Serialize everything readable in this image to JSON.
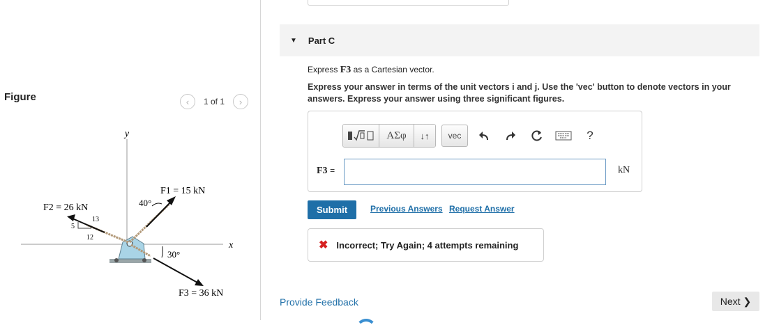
{
  "figure": {
    "title": "Figure",
    "pager_text": "1 of 1",
    "labels": {
      "y_axis": "y",
      "x_axis": "x",
      "f1": "F1 = 15 kN",
      "f2": "F2 = 26 kN",
      "f3": "F3 = 36 kN",
      "angle_40": "40°",
      "angle_30": "30°",
      "slope_5": "5",
      "slope_12": "12",
      "slope_13": "13"
    }
  },
  "part": {
    "caret": "▼",
    "title": "Part C",
    "prompt_prefix": "Express",
    "prompt_var": "F3",
    "prompt_suffix": "as a Cartesian vector.",
    "instructions": "Express your answer in terms of the unit vectors i and j. Use the 'vec' button to denote vectors in your answers. Express your answer using three significant figures."
  },
  "toolbar": {
    "symbols_label": "ΑΣφ",
    "updown_label": "↓↑",
    "vec_label": "vec",
    "help_label": "?"
  },
  "answer": {
    "label": "F3",
    "equals": "=",
    "value": "",
    "unit": "kN"
  },
  "actions": {
    "submit_label": "Submit",
    "previous_answers_label": "Previous Answers",
    "request_answer_label": "Request Answer"
  },
  "feedback": {
    "icon": "x-mark",
    "message": "Incorrect; Try Again; 4 attempts remaining"
  },
  "footer": {
    "provide_feedback_label": "Provide Feedback",
    "next_label": "Next"
  },
  "colors": {
    "link": "#1f6fa8",
    "submit_bg": "#1f6fa8",
    "error": "#d62020"
  }
}
